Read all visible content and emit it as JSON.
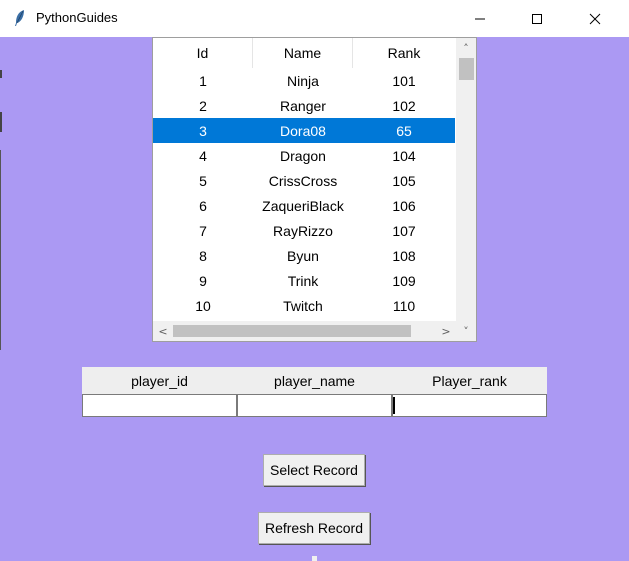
{
  "window": {
    "title": "PythonGuides",
    "icon": "feather-icon",
    "controls": [
      "minimize-icon",
      "maximize-icon",
      "close-icon"
    ]
  },
  "colors": {
    "background": "#ab99f3",
    "selection": "#0078d7"
  },
  "tree": {
    "columns": [
      "Id",
      "Name",
      "Rank"
    ],
    "rows": [
      {
        "id": "1",
        "name": "Ninja",
        "rank": "101"
      },
      {
        "id": "2",
        "name": "Ranger",
        "rank": "102"
      },
      {
        "id": "3",
        "name": "Dora08",
        "rank": "65"
      },
      {
        "id": "4",
        "name": "Dragon",
        "rank": "104"
      },
      {
        "id": "5",
        "name": "CrissCross",
        "rank": "105"
      },
      {
        "id": "6",
        "name": "ZaqueriBlack",
        "rank": "106"
      },
      {
        "id": "7",
        "name": "RayRizzo",
        "rank": "107"
      },
      {
        "id": "8",
        "name": "Byun",
        "rank": "108"
      },
      {
        "id": "9",
        "name": "Trink",
        "rank": "109"
      },
      {
        "id": "10",
        "name": "Twitch",
        "rank": "110"
      }
    ],
    "selected_row": 2,
    "scroll_arrows": {
      "up": "˄",
      "down": "˅",
      "left": "<",
      "right": ">"
    }
  },
  "form": {
    "labels": [
      "player_id",
      "player_name",
      "Player_rank"
    ],
    "values": [
      "",
      "",
      ""
    ]
  },
  "buttons": {
    "select": "Select Record",
    "refresh": "Refresh Record"
  }
}
